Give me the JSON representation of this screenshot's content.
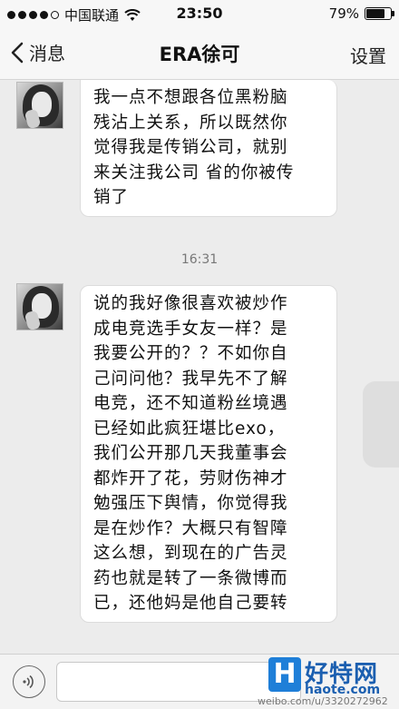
{
  "status_bar": {
    "carrier": "中国联通",
    "time": "23:50",
    "battery_percent": "79%",
    "battery_level": 0.79,
    "signal_bars_filled": 4,
    "signal_bars_total": 5
  },
  "nav": {
    "back_label": "消息",
    "title": "ERA徐可",
    "right_label": "设置"
  },
  "chat": {
    "messages": [
      {
        "lines": [
          "我一点不想跟各位黑粉脑",
          "残沾上关系，所以既然你",
          "觉得我是传销公司，就别",
          "来关注我公司 省的你被传",
          "销了"
        ]
      },
      {
        "lines": [
          "说的我好像很喜欢被炒作",
          "成电竞选手女友一样？是",
          "我要公开的？？不如你自",
          "己问问他？我早先不了解",
          "电竞，还不知道粉丝境遇",
          "已经如此疯狂堪比exo，",
          "我们公开那几天我董事会",
          "都炸开了花，劳财伤神才",
          "勉强压下舆情，你觉得我",
          "是在炒作？大概只有智障",
          "这么想，到现在的广告灵",
          "药也就是转了一条微博而",
          "已，还他妈是他自己要转"
        ]
      }
    ],
    "timestamp": "16:31"
  },
  "watermark": {
    "logo_letter": "H",
    "site_name": "好特网",
    "domain": "haote.com",
    "weibo": "weibo.com/u/3320272962"
  }
}
